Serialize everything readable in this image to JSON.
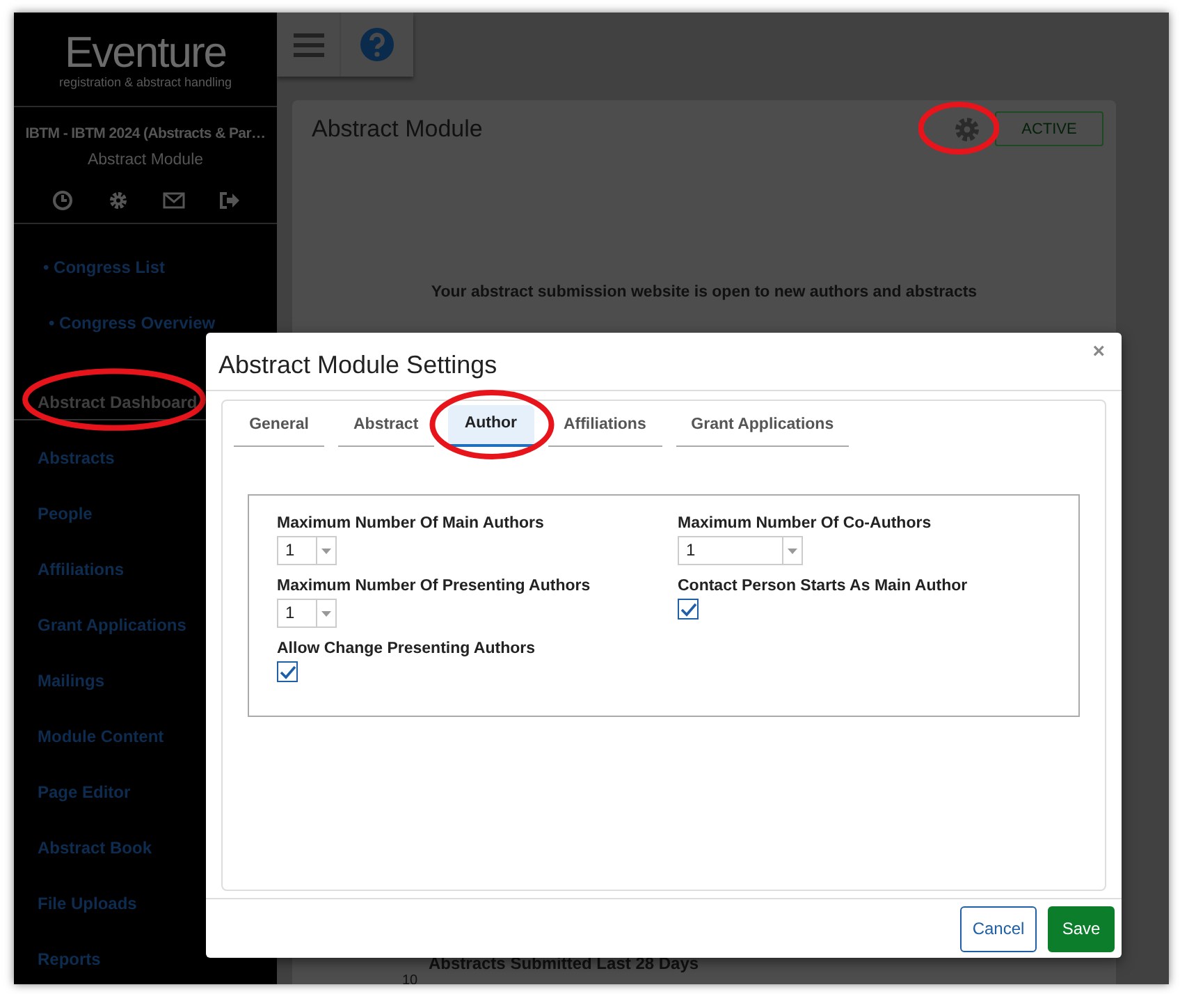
{
  "sidebar": {
    "logo": "Eventure",
    "tagline": "registration & abstract handling",
    "event": "IBTM - IBTM 2024 (Abstracts & Par…",
    "module": "Abstract Module",
    "links": [
      {
        "label": "• Congress List"
      },
      {
        "label": "• Congress Overview"
      }
    ],
    "items": [
      {
        "label": "Abstract Dashboard",
        "selected": true,
        "circled": true
      },
      {
        "label": "Abstracts",
        "selected": false,
        "circled": false
      },
      {
        "label": "People",
        "selected": false,
        "circled": false
      },
      {
        "label": "Affiliations",
        "selected": false,
        "circled": false
      },
      {
        "label": "Grant Applications",
        "selected": false,
        "circled": false
      },
      {
        "label": "Mailings",
        "selected": false,
        "circled": false
      },
      {
        "label": "Module Content",
        "selected": false,
        "circled": false
      },
      {
        "label": "Page Editor",
        "selected": false,
        "circled": false
      },
      {
        "label": "Abstract Book",
        "selected": false,
        "circled": false
      },
      {
        "label": "File Uploads",
        "selected": false,
        "circled": false
      },
      {
        "label": "Reports",
        "selected": false,
        "circled": false
      }
    ]
  },
  "card": {
    "title": "Abstract Module",
    "settings_circled": true,
    "status": "ACTIVE",
    "message": "Your abstract submission website is open to new authors and abstracts",
    "chart_title": "Abstracts Submitted Last 28 Days",
    "axis_tick": "10"
  },
  "modal": {
    "title": "Abstract Module Settings",
    "close": "×",
    "tabs": [
      {
        "label": "General",
        "selected": false,
        "circled": false
      },
      {
        "label": "Abstract",
        "selected": false,
        "circled": false
      },
      {
        "label": "Author",
        "selected": true,
        "circled": true
      },
      {
        "label": "Affiliations",
        "selected": false,
        "circled": false
      },
      {
        "label": "Grant Applications",
        "selected": false,
        "circled": false
      }
    ],
    "fields": [
      {
        "kind": "select",
        "label": "Maximum Number Of Main Authors",
        "value": "1",
        "wide": false
      },
      {
        "kind": "select",
        "label": "Maximum Number Of Co-Authors",
        "value": "1",
        "wide": true
      },
      {
        "kind": "select",
        "label": "Maximum Number Of Presenting Authors",
        "value": "1",
        "wide": false
      },
      {
        "kind": "checkbox",
        "label": "Contact Person Starts As Main Author",
        "checked": true
      },
      {
        "kind": "checkbox",
        "label": "Allow Change Presenting Authors",
        "checked": true
      }
    ],
    "buttons": [
      {
        "label": "Cancel",
        "kind": "secondary"
      },
      {
        "label": "Save",
        "kind": "primary"
      }
    ]
  }
}
